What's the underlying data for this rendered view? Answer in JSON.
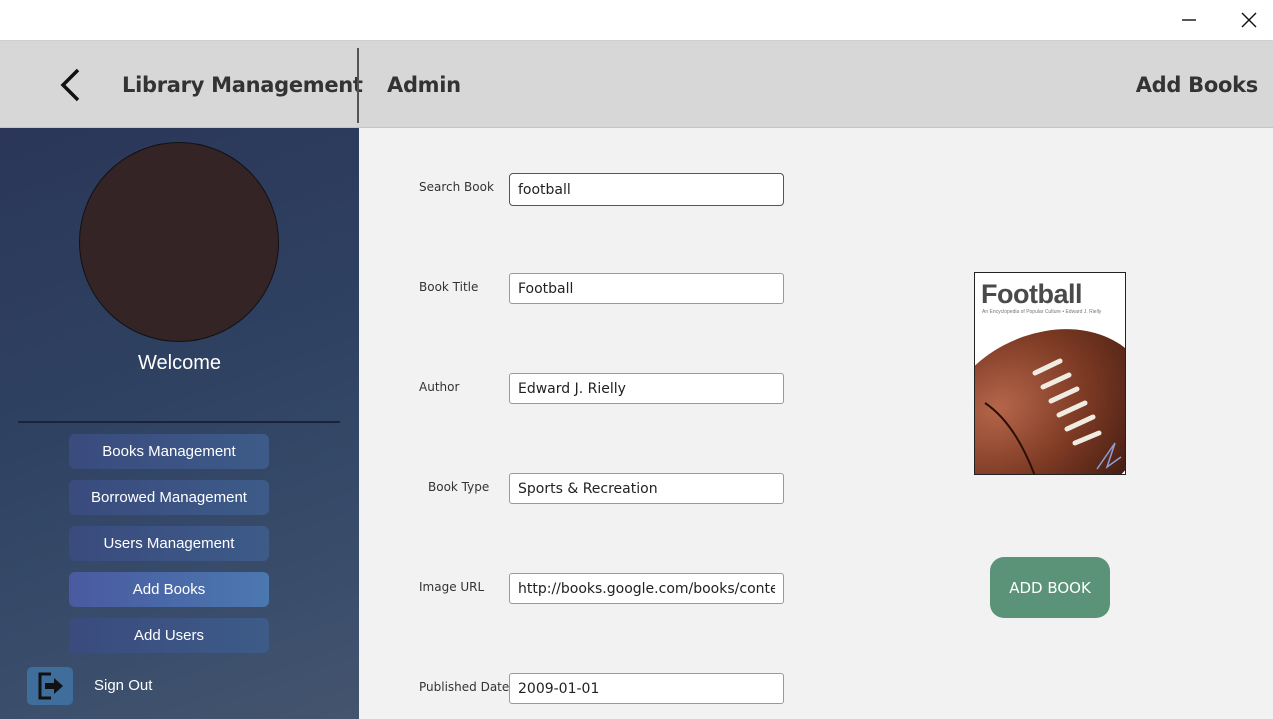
{
  "header": {
    "app_title": "Library Management",
    "role": "Admin",
    "page_title": "Add Books"
  },
  "sidebar": {
    "welcome": "Welcome",
    "nav": [
      {
        "label": "Books Management",
        "active": false
      },
      {
        "label": "Borrowed Management",
        "active": false
      },
      {
        "label": "Users Management",
        "active": false
      },
      {
        "label": "Add Books",
        "active": true
      },
      {
        "label": "Add Users",
        "active": false
      }
    ],
    "sign_out": "Sign Out"
  },
  "form": {
    "search": {
      "label": "Search Book",
      "value": "football"
    },
    "title": {
      "label": "Book Title",
      "value": "Football"
    },
    "author": {
      "label": "Author",
      "value": "Edward J. Rielly"
    },
    "type": {
      "label": "Book Type",
      "value": "Sports & Recreation"
    },
    "image_url": {
      "label": "Image URL",
      "value": "http://books.google.com/books/content"
    },
    "published": {
      "label": "Published Date",
      "value": "2009-01-01"
    }
  },
  "cover": {
    "title": "Football",
    "subtitle": "An Encyclopedia of Popular Culture • Edward J. Rielly"
  },
  "actions": {
    "add_book": "ADD BOOK"
  },
  "colors": {
    "sidebar": "#2f4262",
    "header": "#d7d7d7",
    "add_button": "#5a9377",
    "avatar": "#352426"
  }
}
